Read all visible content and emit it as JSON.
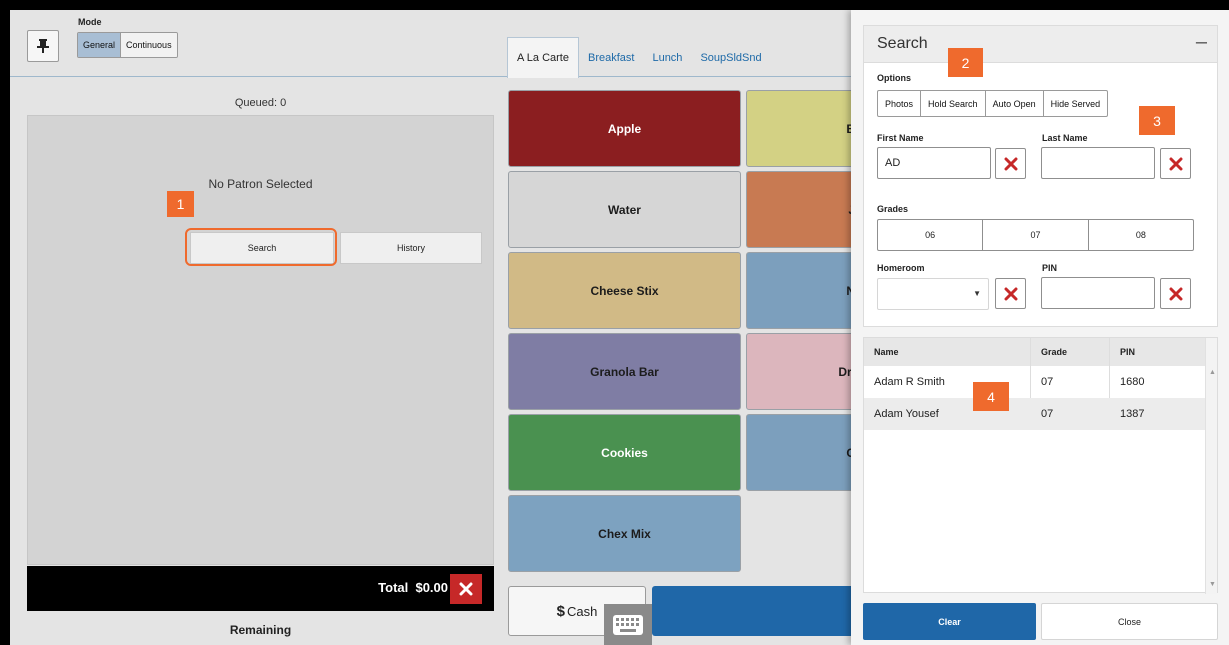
{
  "header": {
    "mode_label": "Mode",
    "mode_options": [
      "General",
      "Continuous"
    ],
    "selected_mode": "General",
    "pin_icon": "pin-icon"
  },
  "menu_tabs": [
    "A La Carte",
    "Breakfast",
    "Lunch",
    "SoupSldSnd"
  ],
  "active_tab": "A La Carte",
  "left_panel": {
    "queued": "Queued: 0",
    "no_patron": "No Patron Selected",
    "search_label": "Search",
    "history_label": "History",
    "total": "Total  $0.00",
    "remaining": "Remaining"
  },
  "items": [
    {
      "label": "Apple",
      "color": "#8b1e20"
    },
    {
      "label": "B",
      "color": "#d3d184"
    },
    {
      "label": "Water",
      "color": "#d6d6d6"
    },
    {
      "label": "J",
      "color": "#c87a52"
    },
    {
      "label": "Cheese Stix",
      "color": "#d1ba86"
    },
    {
      "label": "N",
      "color": "#7c9fbd"
    },
    {
      "label": "Granola Bar",
      "color": "#7f7da4"
    },
    {
      "label": "Dri",
      "color": "#dcb6bd"
    },
    {
      "label": "Cookies",
      "color": "#4a9150"
    },
    {
      "label": "C",
      "color": "#7c9fbd"
    },
    {
      "label": "Chex Mix",
      "color": "#7da2c0"
    }
  ],
  "bottom": {
    "cash_symbol": "$",
    "cash_label": "Cash",
    "keyboard_icon": "keyboard-icon"
  },
  "search_panel": {
    "title": "Search",
    "collapse_symbol": "–",
    "options_label": "Options",
    "options": [
      "Photos",
      "Hold Search",
      "Auto Open",
      "Hide Served"
    ],
    "first_name_label": "First Name",
    "first_name_value": "AD",
    "last_name_label": "Last Name",
    "last_name_value": "",
    "grades_label": "Grades",
    "grades": [
      "06",
      "07",
      "08"
    ],
    "homeroom_label": "Homeroom",
    "homeroom_value": "",
    "pin_label": "PIN",
    "pin_value": ""
  },
  "results": {
    "columns": [
      "Name",
      "Grade",
      "PIN"
    ],
    "rows": [
      [
        "Adam R Smith",
        "07",
        "1680"
      ],
      [
        "Adam Yousef",
        "07",
        "1387"
      ]
    ]
  },
  "actions": {
    "clear_label": "Clear",
    "close_label": "Close"
  },
  "callouts": [
    "1",
    "2",
    "3",
    "4"
  ],
  "colors": {
    "accent_blue": "#1f67a8",
    "callout_orange": "#ef6a2d",
    "delete_red": "#c62828"
  }
}
